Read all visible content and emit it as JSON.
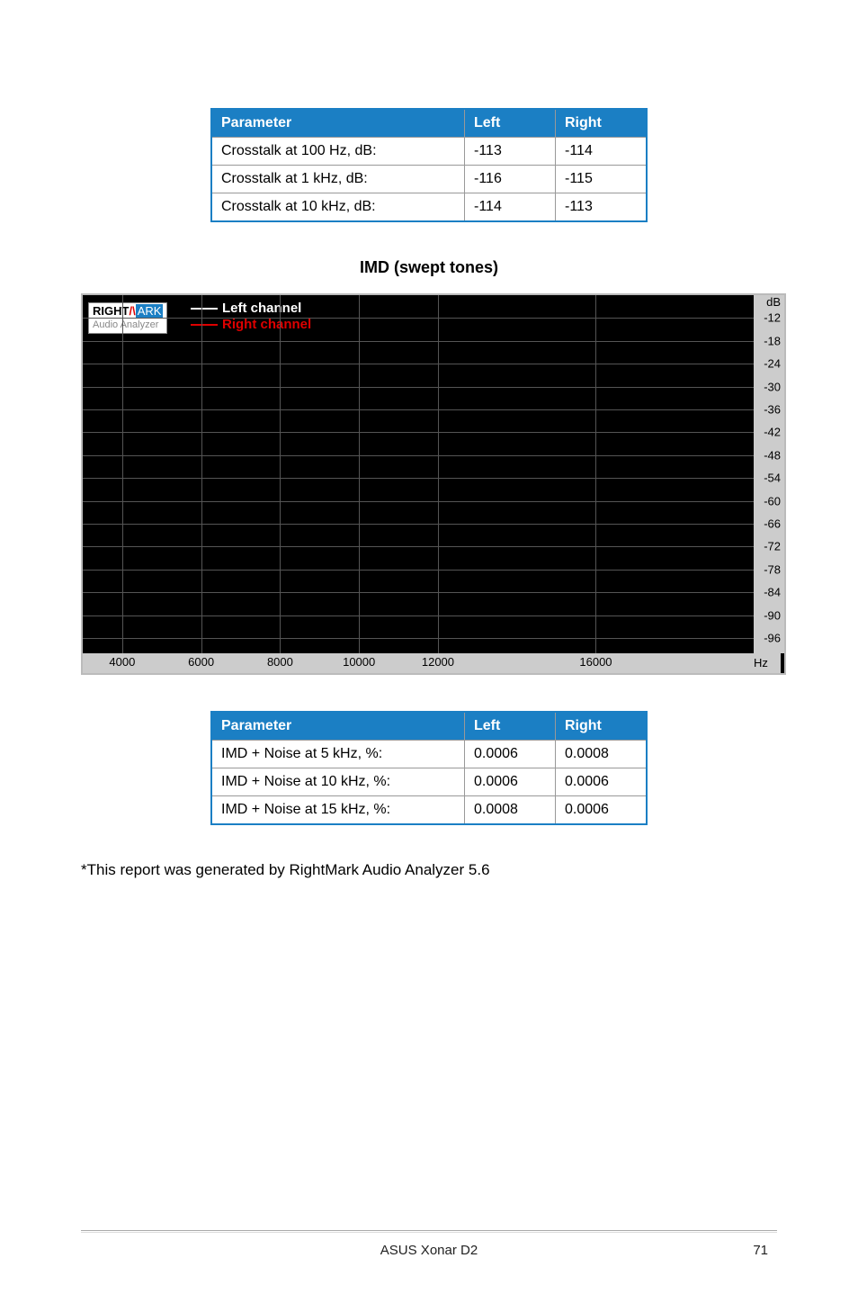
{
  "table1": {
    "headers": {
      "param": "Parameter",
      "left": "Left",
      "right": "Right"
    },
    "rows": [
      {
        "param": "Crosstalk at 100 Hz, dB:",
        "left": "-113",
        "right": "-114"
      },
      {
        "param": "Crosstalk at 1 kHz, dB:",
        "left": "-116",
        "right": "-115"
      },
      {
        "param": "Crosstalk at 10 kHz, dB:",
        "left": "-114",
        "right": "-113"
      }
    ]
  },
  "chart_section_title": "IMD (swept tones)",
  "chart_data": {
    "type": "line",
    "title": "IMD (swept tones)",
    "xlabel": "Hz",
    "ylabel": "dB",
    "x_ticks": [
      4000,
      6000,
      8000,
      10000,
      12000,
      16000
    ],
    "y_ticks": [
      -12,
      -18,
      -24,
      -30,
      -36,
      -42,
      -48,
      -54,
      -60,
      -66,
      -72,
      -78,
      -84,
      -90,
      -96
    ],
    "xlim": [
      3000,
      20000
    ],
    "ylim": [
      -100,
      -6
    ],
    "series": [
      {
        "name": "Left channel",
        "color": "#ffffff"
      },
      {
        "name": "Right channel",
        "color": "#dd0000"
      }
    ],
    "legend_brand": {
      "right": "RIGHT",
      "ark": "ARK",
      "sub": "Audio Analyzer"
    }
  },
  "table2": {
    "headers": {
      "param": "Parameter",
      "left": "Left",
      "right": "Right"
    },
    "rows": [
      {
        "param": "IMD + Noise at 5 kHz, %:",
        "left": "0.0006",
        "right": "0.0008"
      },
      {
        "param": "IMD + Noise at 10 kHz, %:",
        "left": "0.0006",
        "right": "0.0006"
      },
      {
        "param": "IMD + Noise at 15 kHz, %:",
        "left": "0.0008",
        "right": "0.0006"
      }
    ]
  },
  "footnote": "*This report was generated by RightMark Audio Analyzer 5.6",
  "footer": {
    "product": "ASUS Xonar D2",
    "page": "71"
  }
}
